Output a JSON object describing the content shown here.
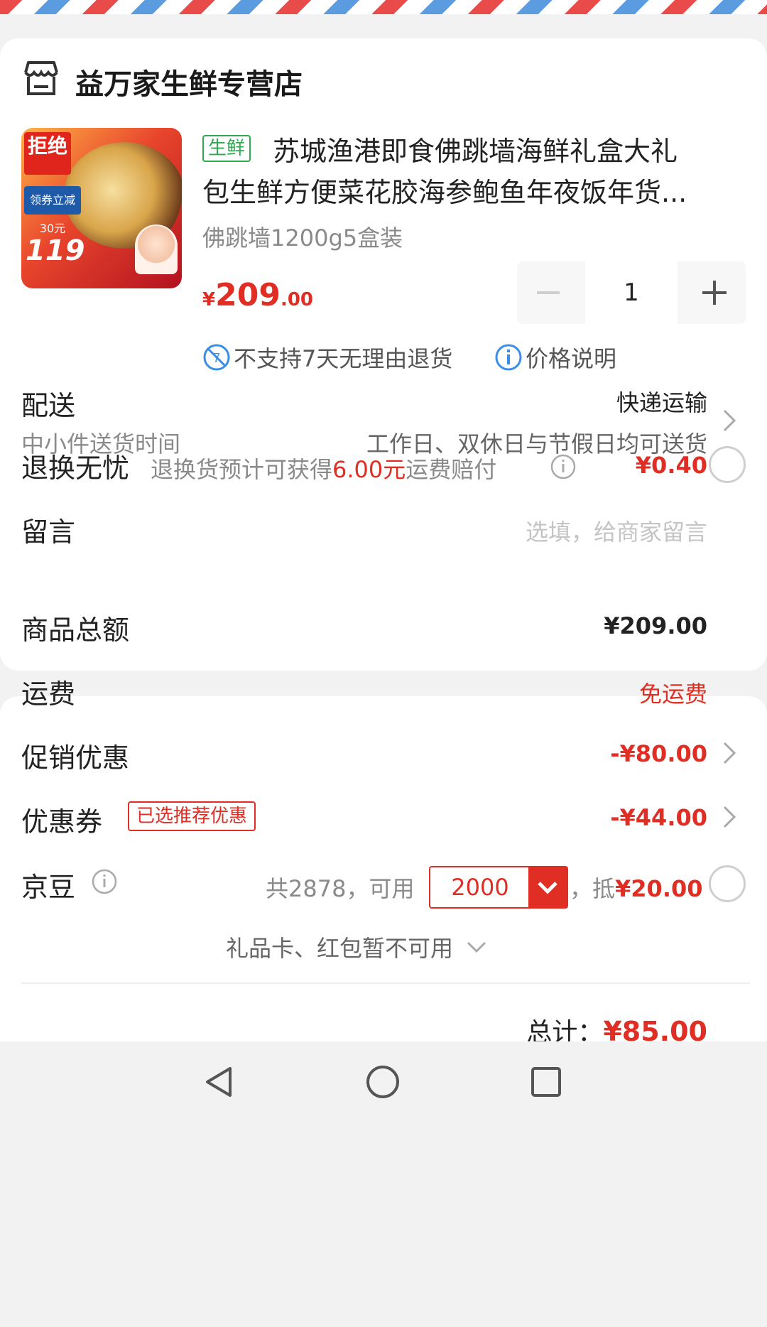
{
  "shop": {
    "name": "益万家生鲜专营店"
  },
  "product": {
    "image_text": {
      "badge": "拒绝",
      "coupon": "领券立减30元",
      "price": "119"
    },
    "tag": "生鲜",
    "title_line1": "苏城渔港即食佛跳墙海鲜礼盒大礼",
    "title_line2": "包生鲜方便菜花胶海参鲍鱼年夜饭年货...",
    "variant": "佛跳墙1200g5盒装",
    "price_symbol": "¥",
    "price_int": "209",
    "price_dec": ".00",
    "quantity": "1",
    "policies": {
      "return_text": "不支持7天无理由退货",
      "price_info": "价格说明"
    }
  },
  "delivery": {
    "label": "配送",
    "method": "快递运输",
    "time_label": "中小件送货时间",
    "time_value": "工作日、双休日与节假日均可送货"
  },
  "return_insurance": {
    "label": "退换无忧",
    "desc_prefix": "退换货预计可获得",
    "desc_amount": "6.00元",
    "desc_suffix": "运费赔付",
    "price": "¥0.40"
  },
  "message": {
    "label": "留言",
    "placeholder": "选填，给商家留言"
  },
  "summary": {
    "goods_total_label": "商品总额",
    "goods_total": "¥209.00",
    "shipping_label": "运费",
    "shipping": "免运费",
    "promo_label": "促销优惠",
    "promo": "-¥80.00",
    "coupon_label": "优惠券",
    "coupon_tag": "已选推荐优惠",
    "coupon": "-¥44.00",
    "jingdou_label": "京豆",
    "jingdou_total": "共2878，可用",
    "jingdou_amount": "2000",
    "jingdou_deduct_prefix": "，抵",
    "jingdou_deduct": "¥20.00",
    "giftcard_text": "礼品卡、红包暂不可用",
    "total_label": "总计：",
    "total": "¥85.00"
  },
  "colors": {
    "accent_red": "#e02e24",
    "fresh_green": "#2fa84f",
    "info_blue": "#3a8ee6"
  },
  "icons": {
    "store": "store-icon",
    "no_return": "no-return-icon",
    "info": "info-icon",
    "chevron": "chevron-right-icon",
    "dropdown": "chevron-down-icon",
    "nav_back": "back-triangle-icon",
    "nav_home": "home-circle-icon",
    "nav_recent": "recent-square-icon"
  }
}
